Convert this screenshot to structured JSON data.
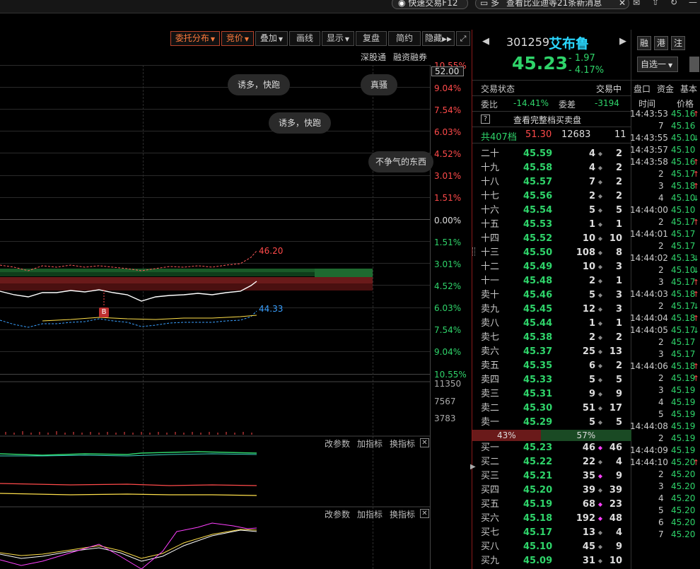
{
  "topbar": {
    "tab1": "快速交易F12",
    "tab2_prefix": "多",
    "tab2": "查看比亚迪等21条新消息"
  },
  "toolbar": {
    "buttons": [
      "委托分布",
      "竞价",
      "叠加",
      "画线",
      "显示",
      "复盘",
      "简约",
      "隐藏"
    ],
    "sub1": "深股通",
    "sub2": "融资融券"
  },
  "y_left": [
    "52.00",
    "9.04%",
    "7.54%",
    "6.03%",
    "4.52%",
    "3.01%",
    "1.51%",
    "0.00%",
    "1.51%",
    "3.01%",
    "4.52%",
    "6.03%",
    "7.54%",
    "9.04%",
    "10.55%"
  ],
  "y_top_pct": "10.55%",
  "bubbles": [
    "诱多，快跑",
    "真骚",
    "诱多，快跑",
    "不争气的东西"
  ],
  "price_labels": {
    "high": "46.20",
    "low": "44.33",
    "marker": "B"
  },
  "vol_labels": [
    "11350",
    "7567",
    "3783"
  ],
  "ind_controls": {
    "param": "改参数",
    "add": "加指标",
    "swap": "换指标"
  },
  "stock": {
    "code": "301259",
    "name": "艾布鲁",
    "price": "45.23",
    "change": "- 1.97",
    "change_pct": "- 4.17%",
    "b1": "融",
    "b2": "港",
    "b3": "注",
    "select": "自选一"
  },
  "status": {
    "label": "交易状态",
    "value": "交易中"
  },
  "ratio": {
    "label1": "委比",
    "value1": "-14.41%",
    "label2": "委差",
    "value2": "-3194"
  },
  "full_book": "查看完整档买卖盘",
  "summary": {
    "label": "共407档",
    "price": "51.30",
    "vol": "12683",
    "count": "11"
  },
  "asks": [
    {
      "lv": "二十",
      "p": "45.59",
      "v": "4",
      "c": "2"
    },
    {
      "lv": "十九",
      "p": "45.58",
      "v": "4",
      "c": "2"
    },
    {
      "lv": "十八",
      "p": "45.57",
      "v": "7",
      "c": "2"
    },
    {
      "lv": "十七",
      "p": "45.56",
      "v": "2",
      "c": "2"
    },
    {
      "lv": "十六",
      "p": "45.54",
      "v": "5",
      "c": "5"
    },
    {
      "lv": "十五",
      "p": "45.53",
      "v": "1",
      "c": "1"
    },
    {
      "lv": "十四",
      "p": "45.52",
      "v": "10",
      "c": "10"
    },
    {
      "lv": "十三",
      "p": "45.50",
      "v": "108",
      "c": "8"
    },
    {
      "lv": "十二",
      "p": "45.49",
      "v": "10",
      "c": "3"
    },
    {
      "lv": "十一",
      "p": "45.48",
      "v": "2",
      "c": "1"
    },
    {
      "lv": "卖十",
      "p": "45.46",
      "v": "5",
      "c": "3"
    },
    {
      "lv": "卖九",
      "p": "45.45",
      "v": "12",
      "c": "3"
    },
    {
      "lv": "卖八",
      "p": "45.44",
      "v": "1",
      "c": "1"
    },
    {
      "lv": "卖七",
      "p": "45.38",
      "v": "2",
      "c": "2"
    },
    {
      "lv": "卖六",
      "p": "45.37",
      "v": "25",
      "c": "13"
    },
    {
      "lv": "卖五",
      "p": "45.35",
      "v": "6",
      "c": "2"
    },
    {
      "lv": "卖四",
      "p": "45.33",
      "v": "5",
      "c": "5"
    },
    {
      "lv": "卖三",
      "p": "45.31",
      "v": "9",
      "c": "9"
    },
    {
      "lv": "卖二",
      "p": "45.30",
      "v": "51",
      "c": "17"
    },
    {
      "lv": "卖一",
      "p": "45.29",
      "v": "5",
      "c": "5"
    }
  ],
  "balance": {
    "sell": "43%",
    "buy": "57%",
    "sell_frac": 0.43
  },
  "bids": [
    {
      "lv": "买一",
      "p": "45.23",
      "v": "46",
      "c": "46",
      "mark": true
    },
    {
      "lv": "买二",
      "p": "45.22",
      "v": "22",
      "c": "4",
      "mark": false
    },
    {
      "lv": "买三",
      "p": "45.21",
      "v": "35",
      "c": "9",
      "mark": true
    },
    {
      "lv": "买四",
      "p": "45.20",
      "v": "39",
      "c": "39",
      "mark": false
    },
    {
      "lv": "买五",
      "p": "45.19",
      "v": "68",
      "c": "23",
      "mark": true
    },
    {
      "lv": "买六",
      "p": "45.18",
      "v": "192",
      "c": "48",
      "mark": true
    },
    {
      "lv": "买七",
      "p": "45.17",
      "v": "13",
      "c": "4",
      "mark": false
    },
    {
      "lv": "买八",
      "p": "45.10",
      "v": "45",
      "c": "9",
      "mark": false
    },
    {
      "lv": "买九",
      "p": "45.09",
      "v": "31",
      "c": "10",
      "mark": false
    }
  ],
  "tabs": [
    "盘口",
    "资金",
    "基本"
  ],
  "tick_head": {
    "time": "时间",
    "price": "价格"
  },
  "ticks": [
    {
      "t": "14:43:53",
      "p": "45.16",
      "a": "up"
    },
    {
      "v": "7",
      "p": "45.16",
      "a": ""
    },
    {
      "t": "14:43:55",
      "p": "45.10",
      "a": "down"
    },
    {
      "t": "14:43:57",
      "p": "45.10",
      "a": ""
    },
    {
      "t": "14:43:58",
      "p": "45.16",
      "a": "up"
    },
    {
      "v": "2",
      "p": "45.17",
      "a": "up"
    },
    {
      "v": "3",
      "p": "45.18",
      "a": "up"
    },
    {
      "v": "4",
      "p": "45.10",
      "a": "down"
    },
    {
      "t": "14:44:00",
      "p": "45.10",
      "a": ""
    },
    {
      "v": "2",
      "p": "45.17",
      "a": "up"
    },
    {
      "t": "14:44:01",
      "p": "45.17",
      "a": ""
    },
    {
      "v": "2",
      "p": "45.17",
      "a": ""
    },
    {
      "t": "14:44:02",
      "p": "45.13",
      "a": "down"
    },
    {
      "v": "2",
      "p": "45.10",
      "a": "down"
    },
    {
      "v": "3",
      "p": "45.17",
      "a": "up"
    },
    {
      "t": "14:44:03",
      "p": "45.18",
      "a": "up"
    },
    {
      "v": "2",
      "p": "45.17",
      "a": "down"
    },
    {
      "t": "14:44:04",
      "p": "45.18",
      "a": "up"
    },
    {
      "t": "14:44:05",
      "p": "45.17",
      "a": "down"
    },
    {
      "v": "2",
      "p": "45.17",
      "a": ""
    },
    {
      "v": "3",
      "p": "45.17",
      "a": ""
    },
    {
      "t": "14:44:06",
      "p": "45.18",
      "a": "up"
    },
    {
      "v": "2",
      "p": "45.19",
      "a": "up"
    },
    {
      "v": "3",
      "p": "45.19",
      "a": ""
    },
    {
      "v": "4",
      "p": "45.19",
      "a": ""
    },
    {
      "v": "5",
      "p": "45.19",
      "a": ""
    },
    {
      "t": "14:44:08",
      "p": "45.19",
      "a": ""
    },
    {
      "v": "2",
      "p": "45.19",
      "a": ""
    },
    {
      "t": "14:44:09",
      "p": "45.19",
      "a": ""
    },
    {
      "t": "14:44:10",
      "p": "45.20",
      "a": "up"
    },
    {
      "v": "2",
      "p": "45.20",
      "a": ""
    },
    {
      "v": "3",
      "p": "45.20",
      "a": ""
    },
    {
      "v": "4",
      "p": "45.20",
      "a": ""
    },
    {
      "v": "5",
      "p": "45.20",
      "a": ""
    },
    {
      "v": "6",
      "p": "45.20",
      "a": ""
    },
    {
      "v": "7",
      "p": "45.20",
      "a": ""
    }
  ]
}
